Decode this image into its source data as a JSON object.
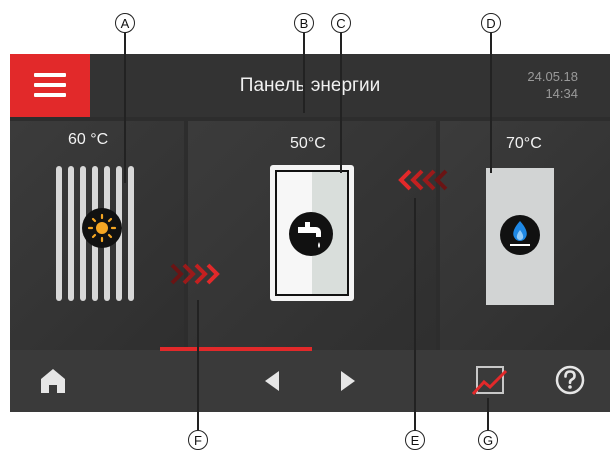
{
  "callouts": {
    "a": "A",
    "b": "B",
    "c": "C",
    "d": "D",
    "e": "E",
    "f": "F",
    "g": "G"
  },
  "header": {
    "title": "Панель энергии",
    "date": "24.05.18",
    "time": "14:34"
  },
  "solar": {
    "temperature": "60 °C",
    "icon": "sun-icon"
  },
  "storage_tank": {
    "temperature": "50°C",
    "icon": "faucet-icon"
  },
  "boiler": {
    "temperature": "70°C",
    "icon": "gas-flame-icon"
  },
  "flows": {
    "solar_to_tank": "chevrons-right-icon",
    "boiler_to_tank": "chevrons-left-icon"
  },
  "bottom_bar": {
    "home_icon": "home-icon",
    "prev_icon": "triangle-left-icon",
    "next_icon": "triangle-right-icon",
    "chart_icon": "energy-chart-icon",
    "help_icon": "question-mark-icon"
  },
  "colors": {
    "accent_red": "#e2292a",
    "sun_orange": "#f5a623",
    "flame_blue": "#1e88e5",
    "background_dark": "#2d2d2d"
  }
}
